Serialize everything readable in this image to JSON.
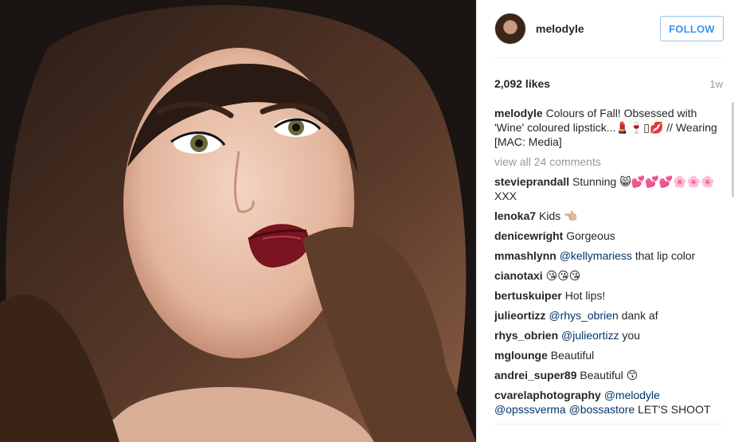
{
  "post": {
    "owner": "melodyle",
    "follow_label": "FOLLOW",
    "likes": "2,092 likes",
    "time_ago": "1w",
    "caption_user": "melodyle",
    "caption_text": "Colours of Fall! Obsessed with 'Wine' coloured lipstick...💄🍷▯💋 // Wearing [MAC: Media]",
    "view_all": "view all 24 comments",
    "colors": {
      "link_blue": "#3897f0",
      "mention": "#003569",
      "muted": "#999999"
    }
  },
  "comments": [
    {
      "user": "stevieprandall",
      "mention": "",
      "text": "Stunning 😸💕💕💕🌸🌸🌸XXX"
    },
    {
      "user": "lenoka7",
      "mention": "",
      "text": "Kids 👈🏼"
    },
    {
      "user": "denicewright",
      "mention": "",
      "text": "Gorgeous"
    },
    {
      "user": "mmashlynn",
      "mention": "@kellymariess",
      "text": "that lip color"
    },
    {
      "user": "cianotaxi",
      "mention": "",
      "text": "😘😘😘"
    },
    {
      "user": "bertuskuiper",
      "mention": "",
      "text": "Hot lips!"
    },
    {
      "user": "julieortizz",
      "mention": "@rhys_obrien",
      "text": "dank af"
    },
    {
      "user": "rhys_obrien",
      "mention": "@julieortizz",
      "text": "you"
    },
    {
      "user": "mglounge",
      "mention": "",
      "text": "Beautiful"
    },
    {
      "user": "andrei_super89",
      "mention": "",
      "text": "Beautiful 😙"
    },
    {
      "user": "cvarelaphotography",
      "mention": "@melodyle @opsssverma @bossastore",
      "text": "LET'S SHOOT"
    }
  ]
}
